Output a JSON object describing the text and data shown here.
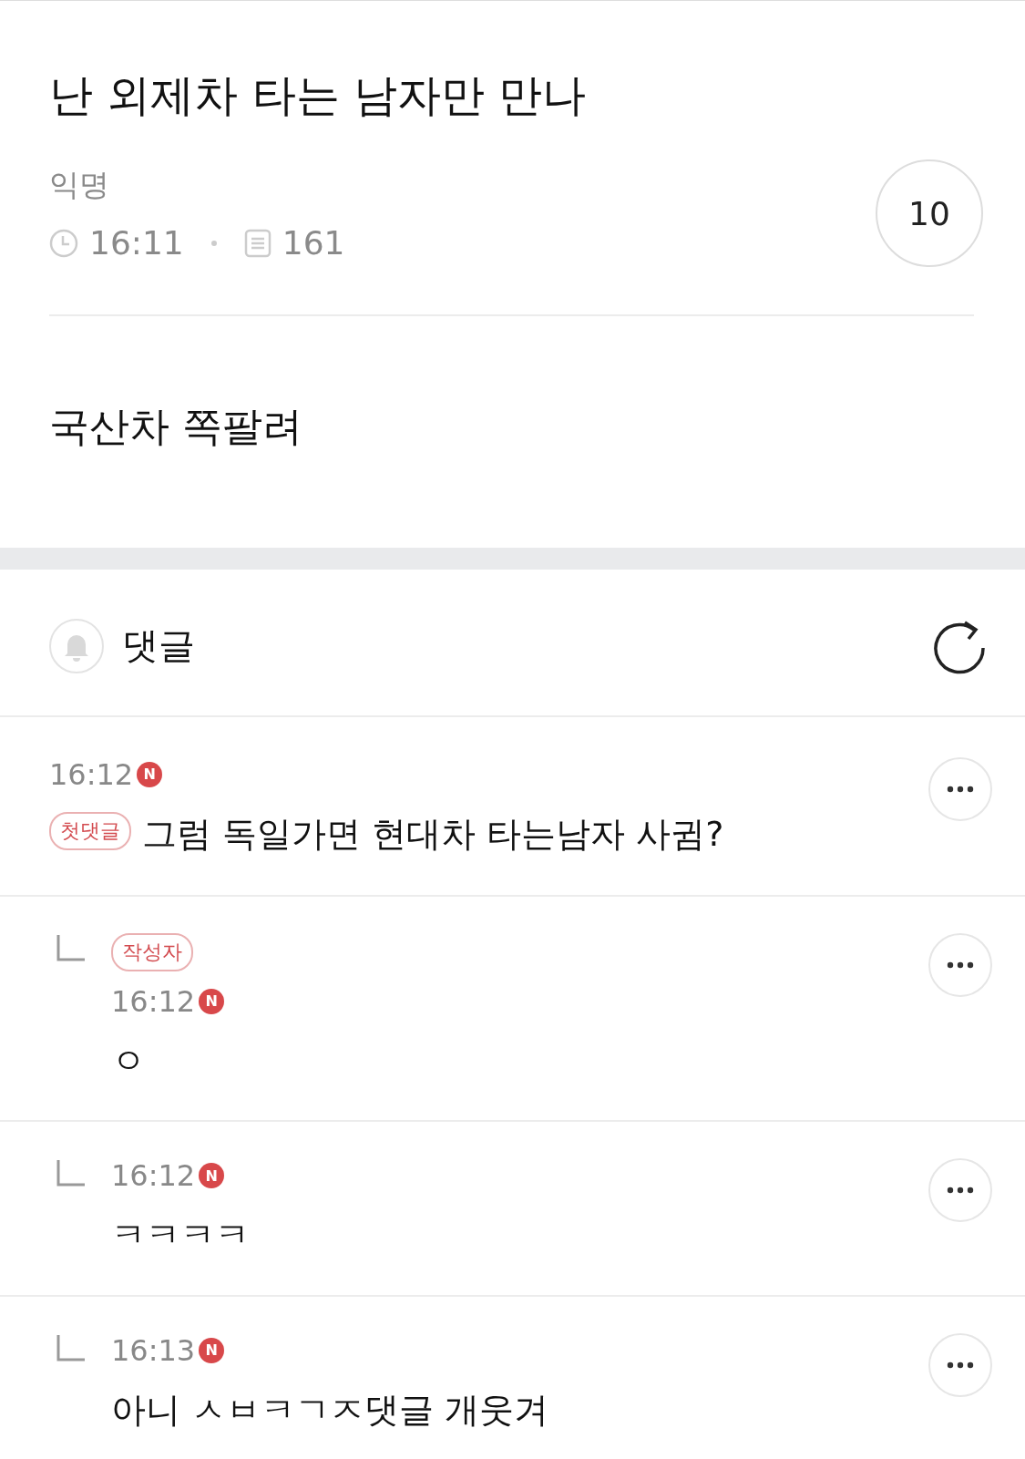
{
  "post": {
    "title": "난 외제차 타는 남자만 만나",
    "author": "익명",
    "time": "16:11",
    "views": "161",
    "like_count": "10",
    "body": "국산차 쪽팔려"
  },
  "comments_header": {
    "title": "댓글",
    "notifications_on": false
  },
  "comments": [
    {
      "kind": "comment",
      "time": "16:12",
      "new_badge": "N",
      "badge": "첫댓글",
      "text": "그럼 독일가면 현대차 타는남자 사귐?"
    },
    {
      "kind": "reply",
      "badge": "작성자",
      "time": "16:12",
      "new_badge": "N",
      "text": "ㅇ"
    },
    {
      "kind": "reply",
      "time": "16:12",
      "new_badge": "N",
      "text": "ㅋㅋㅋㅋ"
    },
    {
      "kind": "reply",
      "time": "16:13",
      "new_badge": "N",
      "text": "아니 ㅅㅂㅋㄱㅈ댓글 개웃겨"
    }
  ]
}
